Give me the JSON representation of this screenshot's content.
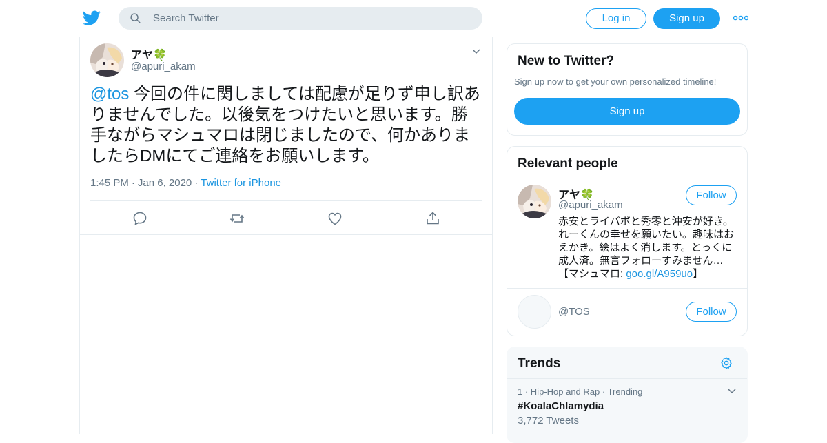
{
  "topbar": {
    "search_placeholder": "Search Twitter",
    "login_label": "Log in",
    "signup_label": "Sign up"
  },
  "tweet": {
    "name": "アヤ🍀",
    "handle": "@apuri_akam",
    "mention": "@tos",
    "text": " 今回の件に関しましては配慮が足りず申し訳ありませんでした。以後気をつけたいと思います。勝手ながらマシュマロは閉じましたので、何かありましたらDMにてご連絡をお願いします。",
    "time": "1:45 PM",
    "date": "Jan 6, 2020",
    "source": "Twitter for iPhone"
  },
  "new_to_twitter": {
    "title": "New to Twitter?",
    "subtitle": "Sign up now to get your own personalized timeline!",
    "signup_label": "Sign up"
  },
  "relevant_people": {
    "title": "Relevant people",
    "people": [
      {
        "name": "アヤ🍀",
        "handle": "@apuri_akam",
        "bio": "赤安とライバボと秀零と沖安が好き。れーくんの幸せを願いたい。趣味はおえかき。絵はよく消します。とっくに成人済。無言フォローすみません…【マシュマロ: ",
        "bio_link": "goo.gl/A959uo",
        "bio_end": "】",
        "follow_label": "Follow"
      },
      {
        "name": "",
        "handle": "@TOS",
        "follow_label": "Follow"
      }
    ]
  },
  "trends": {
    "title": "Trends",
    "items": [
      {
        "rank": "1",
        "category": "Hip-Hop and Rap",
        "label": "Trending",
        "name": "#KoalaChlamydia",
        "count": "3,772 Tweets"
      }
    ]
  },
  "colors": {
    "accent": "#1da1f2",
    "link": "#1b95e0",
    "muted": "#657786",
    "border": "#e6ecf0"
  }
}
